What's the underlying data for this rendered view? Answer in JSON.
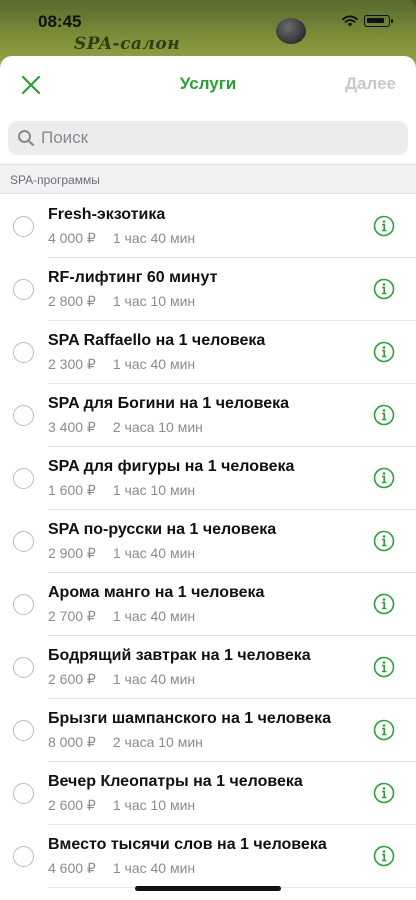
{
  "status": {
    "time": "08:45"
  },
  "brand": {
    "title": "SPA-салон"
  },
  "nav": {
    "title": "Услуги",
    "next_label": "Далее"
  },
  "search": {
    "placeholder": "Поиск",
    "value": ""
  },
  "section": {
    "title": "SPA-программы"
  },
  "colors": {
    "accent": "#2aa136",
    "disabled": "#c8c8cc",
    "secondary_text": "#8b8b90"
  },
  "services": [
    {
      "name": "Fresh-экзотика",
      "price": "4 000 ₽",
      "duration": "1 час 40 мин"
    },
    {
      "name": "RF-лифтинг 60 минут",
      "price": "2 800 ₽",
      "duration": "1 час 10 мин"
    },
    {
      "name": "SPA Raffaello на 1 человека",
      "price": "2 300 ₽",
      "duration": "1 час 40 мин"
    },
    {
      "name": "SPA для Богини на 1 человека",
      "price": "3 400 ₽",
      "duration": "2 часа 10 мин"
    },
    {
      "name": "SPA для фигуры на 1 человека",
      "price": "1 600 ₽",
      "duration": "1 час 10 мин"
    },
    {
      "name": "SPA по-русски на 1 человека",
      "price": "2 900 ₽",
      "duration": "1 час 40 мин"
    },
    {
      "name": "Арома манго на 1 человека",
      "price": "2 700 ₽",
      "duration": "1 час 40 мин"
    },
    {
      "name": "Бодрящий завтрак на 1 человека",
      "price": "2 600 ₽",
      "duration": "1 час 40 мин"
    },
    {
      "name": "Брызги шампанского на 1 человека",
      "price": "8 000 ₽",
      "duration": "2 часа 10 мин"
    },
    {
      "name": "Вечер Клеопатры на 1 человека",
      "price": "2 600 ₽",
      "duration": "1 час 10 мин"
    },
    {
      "name": "Вместо тысячи слов на 1 человека",
      "price": "4 600 ₽",
      "duration": "1 час 40 мин"
    }
  ]
}
